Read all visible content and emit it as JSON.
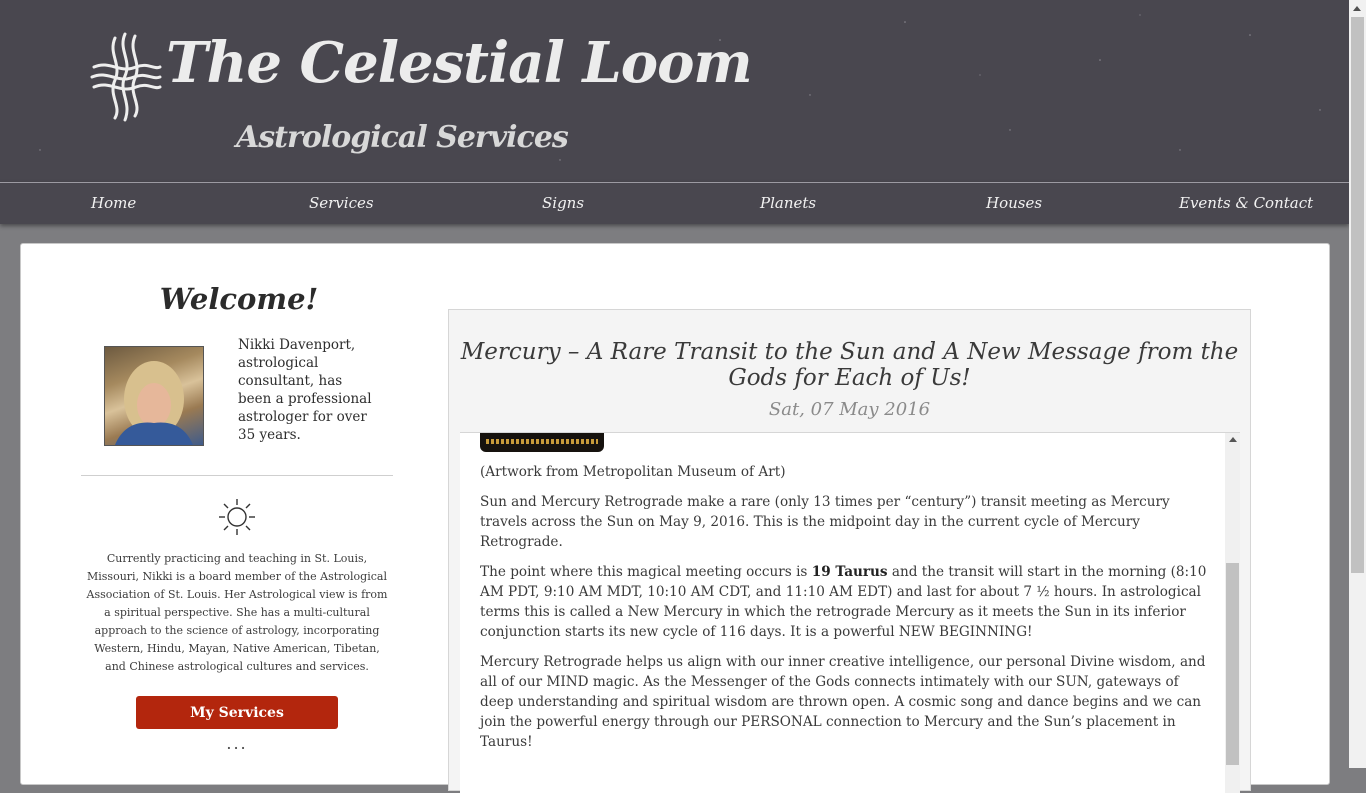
{
  "header": {
    "title": "The Celestial Loom",
    "subtitle": "Astrological Services",
    "logo_icon": "celestial-knot-icon"
  },
  "nav": {
    "items": [
      {
        "label": "Home"
      },
      {
        "label": "Services"
      },
      {
        "label": "Signs"
      },
      {
        "label": "Planets"
      },
      {
        "label": "Houses"
      },
      {
        "label": "Events & Contact"
      }
    ]
  },
  "sidebar": {
    "welcome": "Welcome!",
    "bio": "Nikki Davenport, astrological consultant, has been a professional astrologer for over 35 years.",
    "about": "Currently practicing and teaching in St. Louis, Missouri, Nikki is a board member of the Astrological Association of St. Louis. Her Astrological view is from a spiritual perspective. She has a multi-cultural approach to the science of astrology, incorporating Western, Hindu, Mayan, Native American, Tibetan, and Chinese astrological cultures and services.",
    "services_button": "My Services",
    "more": "...",
    "sun_icon": "sun-icon"
  },
  "article": {
    "title": "Mercury – A Rare Transit to the Sun and A New Message from the Gods for Each of Us!",
    "date": "Sat, 07 May 2016",
    "caption": "(Artwork from Metropolitan Museum of Art)",
    "para1": "Sun and Mercury Retrograde make a rare (only 13 times per “century”) transit meeting as Mercury travels across the Sun on May 9, 2016.  This is the midpoint day in the current  cycle of Mercury Retrograde.",
    "para2_a": "The point where this magical meeting occurs is ",
    "para2_bold": "19 Taurus",
    "para2_b": " and the transit will start in the morning (8:10 AM PDT, 9:10 AM MDT, 10:10 AM CDT, and 11:10 AM EDT) and last for about 7 ½ hours.  In astrological terms this is called a New Mercury in which the retrograde Mercury as it meets the Sun in its inferior conjunction starts its new cycle of 116 days.  It is a powerful NEW BEGINNING!",
    "para3": "Mercury Retrograde helps us align with our inner creative intelligence, our personal Divine wisdom, and all of our MIND magic.  As the Messenger of the Gods connects intimately with our SUN, gateways of deep understanding and spiritual wisdom are thrown open.  A cosmic song and dance begins and we can join the powerful energy through our PERSONAL connection to Mercury and the Sun’s placement in Taurus!"
  },
  "colors": {
    "header_bg": "#49474f",
    "button_bg": "#b3260d",
    "page_bg": "#7d7d80"
  }
}
